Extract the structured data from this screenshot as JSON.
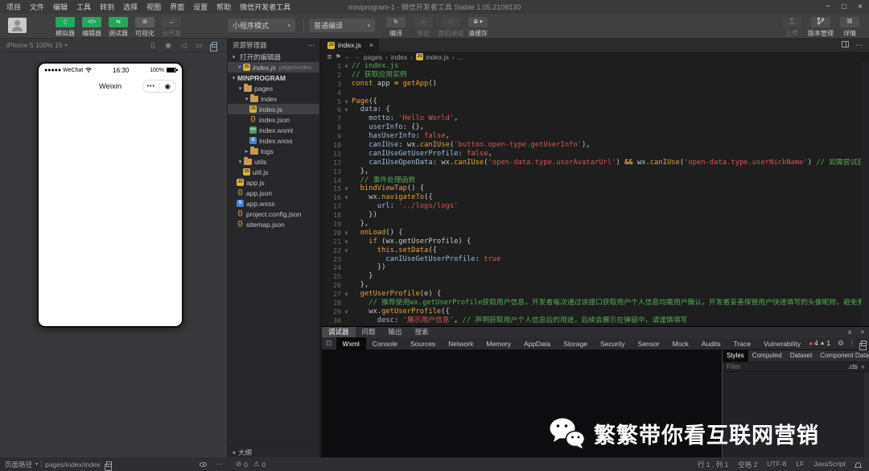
{
  "titlebar": {
    "menus": [
      "项目",
      "文件",
      "编辑",
      "工具",
      "转到",
      "选择",
      "视图",
      "界面",
      "设置",
      "帮助",
      "微信开发者工具"
    ],
    "title": "miniprogram-1 - 微信开发者工具 Stable 1.05.2108130",
    "window_controls": [
      "−",
      "□",
      "×"
    ]
  },
  "toolbar": {
    "mode_buttons": [
      {
        "label": "模拟器",
        "icon": "simulator-icon",
        "state": "on"
      },
      {
        "label": "编辑器",
        "icon": "editor-icon",
        "state": "on"
      },
      {
        "label": "调试器",
        "icon": "debugger-icon",
        "state": "on"
      },
      {
        "label": "可视化",
        "icon": "visual-icon",
        "state": "off"
      },
      {
        "label": "云开发",
        "icon": "cloud-icon",
        "state": "disabled"
      }
    ],
    "mode_select": "小程序模式",
    "compile_select": "普通编译",
    "action_buttons": [
      {
        "label": "编译",
        "icon": "compile-icon",
        "enabled": true
      },
      {
        "label": "预览",
        "icon": "preview-icon",
        "enabled": false
      },
      {
        "label": "真机调试",
        "icon": "remote-debug-icon",
        "enabled": false
      },
      {
        "label": "清缓存",
        "icon": "clear-cache-icon",
        "enabled": true,
        "caret": true
      }
    ],
    "right_buttons": [
      {
        "label": "上传",
        "icon": "upload-icon",
        "enabled": false
      },
      {
        "label": "版本管理",
        "icon": "version-icon",
        "enabled": true
      },
      {
        "label": "详情",
        "icon": "detail-icon",
        "enabled": true
      }
    ]
  },
  "simulator": {
    "device_label": "iPhone 5 100% 16",
    "status_bar": {
      "carrier": "●●●●● WeChat",
      "time": "16:30",
      "battery": "100%"
    },
    "nav_title": "Weixin",
    "capsule_dots": "•••",
    "capsule_target": "◉"
  },
  "explorer": {
    "title": "资源管理器",
    "outline_label": "大纲",
    "rows": [
      {
        "kind": "section",
        "arrow": "down",
        "label": "打开的编辑器",
        "indent": 0
      },
      {
        "kind": "open",
        "close": true,
        "icon": "js",
        "label": "index.js",
        "detail": "pages\\index",
        "indent": 1,
        "selected": true
      },
      {
        "kind": "section",
        "arrow": "down",
        "label": "MINPROGRAM",
        "indent": 0,
        "bold": true
      },
      {
        "kind": "folder",
        "arrow": "down",
        "icon": "folder",
        "label": "pages",
        "indent": 1
      },
      {
        "kind": "folder",
        "arrow": "down",
        "icon": "folder",
        "label": "index",
        "indent": 2
      },
      {
        "kind": "file",
        "icon": "js",
        "label": "index.js",
        "indent": 3,
        "selected": true
      },
      {
        "kind": "file",
        "icon": "json",
        "label": "index.json",
        "indent": 3
      },
      {
        "kind": "file",
        "icon": "wxml",
        "label": "index.wxml",
        "indent": 3
      },
      {
        "kind": "file",
        "icon": "wxss",
        "label": "index.wxss",
        "indent": 3
      },
      {
        "kind": "folder",
        "arrow": "right",
        "icon": "folder",
        "label": "logs",
        "indent": 2
      },
      {
        "kind": "folder",
        "arrow": "down",
        "icon": "folder",
        "label": "utils",
        "indent": 1
      },
      {
        "kind": "file",
        "icon": "js",
        "label": "util.js",
        "indent": 2
      },
      {
        "kind": "file",
        "icon": "js",
        "label": "app.js",
        "indent": 1
      },
      {
        "kind": "file",
        "icon": "json",
        "label": "app.json",
        "indent": 1
      },
      {
        "kind": "file",
        "icon": "wxss",
        "label": "app.wxss",
        "indent": 1
      },
      {
        "kind": "file",
        "icon": "json",
        "label": "project.config.json",
        "indent": 1
      },
      {
        "kind": "file",
        "icon": "json",
        "label": "sitemap.json",
        "indent": 1
      }
    ]
  },
  "editor": {
    "tab": {
      "label": "index.js"
    },
    "breadcrumb": [
      {
        "label": "pages"
      },
      {
        "label": "index"
      },
      {
        "label": "index.js",
        "icon": "js"
      },
      {
        "label": "..."
      }
    ],
    "code_lines": [
      {
        "n": 1,
        "fold": true,
        "t": [
          [
            "c",
            "// index.js"
          ]
        ]
      },
      {
        "n": 2,
        "t": [
          [
            "c",
            "// 获取应用实例"
          ]
        ]
      },
      {
        "n": 3,
        "t": [
          [
            "k",
            "const"
          ],
          [
            "p",
            " app "
          ],
          [
            "o",
            "="
          ],
          [
            "p",
            " "
          ],
          [
            "fn",
            "getApp"
          ],
          [
            "p",
            "()"
          ]
        ]
      },
      {
        "n": 4,
        "t": []
      },
      {
        "n": 5,
        "fold": true,
        "t": [
          [
            "fn",
            "Page"
          ],
          [
            "p",
            "({"
          ]
        ]
      },
      {
        "n": 6,
        "fold": true,
        "t": [
          [
            "p",
            "  "
          ],
          [
            "pr",
            "data"
          ],
          [
            "p",
            ": {"
          ]
        ]
      },
      {
        "n": 7,
        "t": [
          [
            "p",
            "    "
          ],
          [
            "pr",
            "motto"
          ],
          [
            "p",
            ": "
          ],
          [
            "s",
            "'Hello World'"
          ],
          [
            "p",
            ","
          ]
        ]
      },
      {
        "n": 8,
        "t": [
          [
            "p",
            "    "
          ],
          [
            "pr",
            "userInfo"
          ],
          [
            "p",
            ": {},"
          ]
        ]
      },
      {
        "n": 9,
        "t": [
          [
            "p",
            "    "
          ],
          [
            "pr",
            "hasUserInfo"
          ],
          [
            "p",
            ": "
          ],
          [
            "b",
            "false"
          ],
          [
            "p",
            ","
          ]
        ]
      },
      {
        "n": 10,
        "t": [
          [
            "p",
            "    "
          ],
          [
            "pr",
            "canIUse"
          ],
          [
            "p",
            ": wx."
          ],
          [
            "fn",
            "canIUse"
          ],
          [
            "p",
            "("
          ],
          [
            "s",
            "'button.open-type.getUserInfo'"
          ],
          [
            "p",
            "),"
          ]
        ]
      },
      {
        "n": 11,
        "t": [
          [
            "p",
            "    "
          ],
          [
            "pr",
            "canIUseGetUserProfile"
          ],
          [
            "p",
            ": "
          ],
          [
            "b",
            "false"
          ],
          [
            "p",
            ","
          ]
        ]
      },
      {
        "n": 12,
        "t": [
          [
            "p",
            "    "
          ],
          [
            "pr",
            "canIUseOpenData"
          ],
          [
            "p",
            ": wx."
          ],
          [
            "fn",
            "canIUse"
          ],
          [
            "p",
            "("
          ],
          [
            "s",
            "'open-data.type.userAvatarUrl'"
          ],
          [
            "p",
            ") "
          ],
          [
            "o",
            "&&"
          ],
          [
            "p",
            " wx."
          ],
          [
            "fn",
            "canIUse"
          ],
          [
            "p",
            "("
          ],
          [
            "s",
            "'open-data.type.userNickName'"
          ],
          [
            "p",
            ") "
          ],
          [
            "c",
            "// 如需尝试获取用户信息可改为false"
          ]
        ]
      },
      {
        "n": 13,
        "t": [
          [
            "p",
            "  },"
          ]
        ]
      },
      {
        "n": 14,
        "t": [
          [
            "p",
            "  "
          ],
          [
            "c",
            "// 事件处理函数"
          ]
        ]
      },
      {
        "n": 15,
        "fold": true,
        "t": [
          [
            "p",
            "  "
          ],
          [
            "fn",
            "bindViewTap"
          ],
          [
            "p",
            "() {"
          ]
        ]
      },
      {
        "n": 16,
        "fold": true,
        "t": [
          [
            "p",
            "    wx."
          ],
          [
            "fn",
            "navigateTo"
          ],
          [
            "p",
            "({"
          ]
        ]
      },
      {
        "n": 17,
        "t": [
          [
            "p",
            "      "
          ],
          [
            "pr",
            "url"
          ],
          [
            "p",
            ": "
          ],
          [
            "s",
            "'../logs/logs'"
          ]
        ]
      },
      {
        "n": 18,
        "t": [
          [
            "p",
            "    })"
          ]
        ]
      },
      {
        "n": 19,
        "t": [
          [
            "p",
            "  },"
          ]
        ]
      },
      {
        "n": 20,
        "fold": true,
        "t": [
          [
            "p",
            "  "
          ],
          [
            "fn",
            "onLoad"
          ],
          [
            "p",
            "() {"
          ]
        ]
      },
      {
        "n": 21,
        "fold": true,
        "t": [
          [
            "p",
            "    "
          ],
          [
            "k",
            "if"
          ],
          [
            "p",
            " (wx.getUserProfile) {"
          ]
        ]
      },
      {
        "n": 22,
        "fold": true,
        "t": [
          [
            "p",
            "      "
          ],
          [
            "k",
            "this"
          ],
          [
            "p",
            "."
          ],
          [
            "fn",
            "setData"
          ],
          [
            "p",
            "({"
          ]
        ]
      },
      {
        "n": 23,
        "t": [
          [
            "p",
            "        "
          ],
          [
            "pr",
            "canIUseGetUserProfile"
          ],
          [
            "p",
            ": "
          ],
          [
            "b",
            "true"
          ]
        ]
      },
      {
        "n": 24,
        "t": [
          [
            "p",
            "      })"
          ]
        ]
      },
      {
        "n": 25,
        "t": [
          [
            "p",
            "    }"
          ]
        ]
      },
      {
        "n": 26,
        "t": [
          [
            "p",
            "  },"
          ]
        ]
      },
      {
        "n": 27,
        "fold": true,
        "t": [
          [
            "p",
            "  "
          ],
          [
            "fn",
            "getUserProfile"
          ],
          [
            "p",
            "(e) {"
          ]
        ]
      },
      {
        "n": 28,
        "t": [
          [
            "p",
            "    "
          ],
          [
            "c",
            "// 推荐使用wx.getUserProfile获取用户信息，开发者每次通过该接口获取用户个人信息均需用户确认，开发者妥善保管用户快速填写的头像昵称，避免重复弹窗"
          ]
        ]
      },
      {
        "n": 29,
        "fold": true,
        "t": [
          [
            "p",
            "    wx."
          ],
          [
            "fn",
            "getUserProfile"
          ],
          [
            "p",
            "({"
          ]
        ]
      },
      {
        "n": 30,
        "t": [
          [
            "p",
            "      "
          ],
          [
            "pr",
            "desc"
          ],
          [
            "p",
            ": "
          ],
          [
            "s",
            "'展示用户信息'"
          ],
          [
            "p",
            ", "
          ],
          [
            "c",
            "// 声明获取用户个人信息后的用途，后续会展示在弹窗中，请谨慎填写"
          ]
        ]
      }
    ]
  },
  "debugger": {
    "panel_tabs": [
      "调试器",
      "问题",
      "输出",
      "搜索"
    ],
    "active_panel_tab": "调试器",
    "devtools_tabs": [
      "Wxml",
      "Console",
      "Sources",
      "Network",
      "Memory",
      "AppData",
      "Storage",
      "Security",
      "Sensor",
      "Mock",
      "Audits",
      "Trace",
      "Vulnerability"
    ],
    "active_devtools_tab": "Wxml",
    "error_count": "4",
    "warning_count": "1",
    "styles_tabs": [
      "Styles",
      "Computed",
      "Dataset",
      "Component Data"
    ],
    "active_styles_tab": "Styles",
    "styles_more": "»",
    "filter_placeholder": "Filter",
    "cls_label": ".cls",
    "plus_label": "+"
  },
  "statusbar": {
    "left_label": "页面路径",
    "path": "pages/index/index",
    "errors": "0",
    "warnings": "0",
    "right_items": [
      "行 1 , 列 1",
      "空格 2",
      "UTF-8",
      "LF",
      "JavaScript"
    ]
  },
  "watermark": {
    "text": "繁繁带你看互联网营销"
  }
}
